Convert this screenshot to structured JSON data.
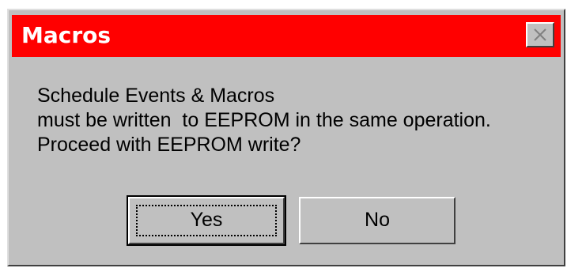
{
  "dialog": {
    "title": "Macros",
    "message_lines": {
      "line1": "Schedule Events & Macros",
      "line2": "must be written  to EEPROM in the same operation.",
      "line3": "Proceed with EEPROM write?"
    },
    "buttons": {
      "yes": "Yes",
      "no": "No"
    }
  },
  "colors": {
    "titlebar": "#ff0000",
    "dialog_bg": "#c0c0c0",
    "title_text": "#ffffff"
  },
  "icons": {
    "close": "close-icon"
  }
}
